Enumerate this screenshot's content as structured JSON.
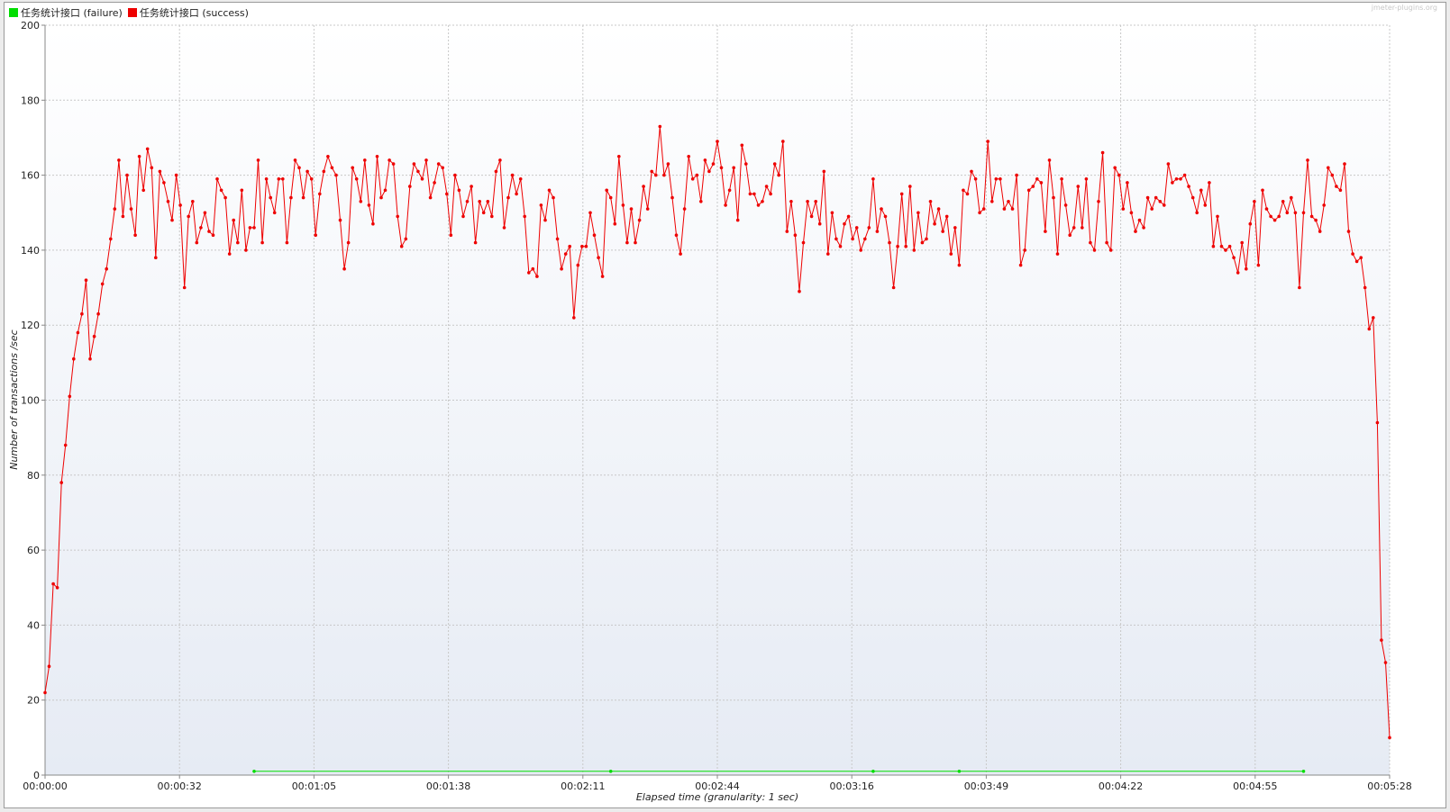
{
  "window": {
    "watermark": "jmeter-plugins.org"
  },
  "legend": {
    "items": [
      {
        "label": "任务统计接口 (failure)",
        "color": "#00dd00"
      },
      {
        "label": "任务统计接口 (success)",
        "color": "#ee0000"
      }
    ]
  },
  "chart_data": {
    "type": "line",
    "xlabel": "Elapsed time (granularity: 1 sec)",
    "ylabel": "Number of transactions /sec",
    "ylim": [
      0,
      200
    ],
    "yticks": [
      0,
      20,
      40,
      60,
      80,
      100,
      120,
      140,
      160,
      180,
      200
    ],
    "xlim_seconds": [
      0,
      328
    ],
    "xticks": [
      {
        "sec": 0,
        "label": "00:00:00"
      },
      {
        "sec": 32.8,
        "label": "00:00:32"
      },
      {
        "sec": 65.6,
        "label": "00:01:05"
      },
      {
        "sec": 98.4,
        "label": "00:01:38"
      },
      {
        "sec": 131.2,
        "label": "00:02:11"
      },
      {
        "sec": 164,
        "label": "00:02:44"
      },
      {
        "sec": 196.8,
        "label": "00:03:16"
      },
      {
        "sec": 229.6,
        "label": "00:03:49"
      },
      {
        "sec": 262.4,
        "label": "00:04:22"
      },
      {
        "sec": 295.2,
        "label": "00:04:55"
      },
      {
        "sec": 328,
        "label": "00:05:28"
      }
    ],
    "grid": true,
    "legend_position": "top-left",
    "series": [
      {
        "name": "任务统计接口 (success)",
        "color": "#ee0000",
        "x_start": 0,
        "x_step": 1,
        "values": [
          22,
          29,
          51,
          50,
          78,
          88,
          101,
          111,
          118,
          123,
          132,
          111,
          117,
          123,
          131,
          135,
          143,
          151,
          164,
          149,
          160,
          151,
          144,
          165,
          156,
          167,
          162,
          138,
          161,
          158,
          153,
          148,
          160,
          152,
          130,
          149,
          153,
          142,
          146,
          150,
          145,
          144,
          159,
          156,
          154,
          139,
          148,
          142,
          156,
          140,
          146,
          146,
          164,
          142,
          159,
          154,
          150,
          159,
          159,
          142,
          154,
          164,
          162,
          154,
          161,
          159,
          144,
          155,
          161,
          165,
          162,
          160,
          148,
          135,
          142,
          162,
          159,
          153,
          164,
          152,
          147,
          165,
          154,
          156,
          164,
          163,
          149,
          141,
          143,
          157,
          163,
          161,
          159,
          164,
          154,
          158,
          163,
          162,
          155,
          144,
          160,
          156,
          149,
          153,
          157,
          142,
          153,
          150,
          153,
          149,
          161,
          164,
          146,
          154,
          160,
          155,
          159,
          149,
          134,
          135,
          133,
          152,
          148,
          156,
          154,
          143,
          135,
          139,
          141,
          122,
          136,
          141,
          141,
          150,
          144,
          138,
          133,
          156,
          154,
          147,
          165,
          152,
          142,
          151,
          142,
          148,
          157,
          151,
          161,
          160,
          173,
          160,
          163,
          154,
          144,
          139,
          151,
          165,
          159,
          160,
          153,
          164,
          161,
          163,
          169,
          162,
          152,
          156,
          162,
          148,
          168,
          163,
          155,
          155,
          152,
          153,
          157,
          155,
          163,
          160,
          169,
          145,
          153,
          144,
          129,
          142,
          153,
          149,
          153,
          147,
          161,
          139,
          150,
          143,
          141,
          147,
          149,
          143,
          146,
          140,
          143,
          146,
          159,
          145,
          151,
          149,
          142,
          130,
          141,
          155,
          141,
          157,
          140,
          150,
          142,
          143,
          153,
          147,
          151,
          145,
          149,
          139,
          146,
          136,
          156,
          155,
          161,
          159,
          150,
          151,
          169,
          153,
          159,
          159,
          151,
          153,
          151,
          160,
          136,
          140,
          156,
          157,
          159,
          158,
          145,
          164,
          154,
          139,
          159,
          152,
          144,
          146,
          157,
          146,
          159,
          142,
          140,
          153,
          166,
          142,
          140,
          162,
          160,
          151,
          158,
          150,
          145,
          148,
          146,
          154,
          151,
          154,
          153,
          152,
          163,
          158,
          159,
          159,
          160,
          157,
          154,
          150,
          156,
          152,
          158,
          141,
          149,
          141,
          140,
          141,
          138,
          134,
          142,
          135,
          147,
          153,
          136,
          156,
          151,
          149,
          148,
          149,
          153,
          150,
          154,
          150,
          130,
          150,
          164,
          149,
          148,
          145,
          152,
          162,
          160,
          157,
          156,
          163,
          145,
          139,
          137,
          138,
          130,
          119,
          122,
          94,
          36,
          30,
          10
        ]
      },
      {
        "name": "任务统计接口 (failure)",
        "color": "#00dd00",
        "points": [
          {
            "x": 51,
            "y": 1
          },
          {
            "x": 138,
            "y": 1
          },
          {
            "x": 202,
            "y": 1
          },
          {
            "x": 223,
            "y": 1
          },
          {
            "x": 307,
            "y": 1
          }
        ]
      }
    ]
  }
}
